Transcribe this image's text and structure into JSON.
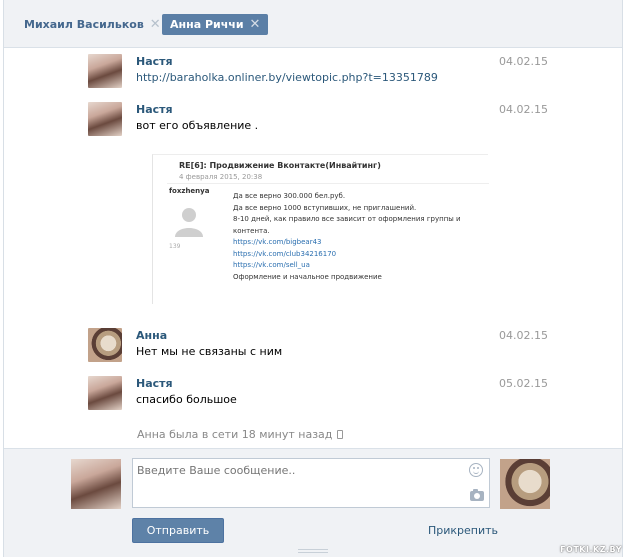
{
  "tabs": [
    {
      "label": "Михаил Васильков",
      "close": "✕"
    },
    {
      "label": "Анна Риччи",
      "close": "✕"
    }
  ],
  "messages": [
    {
      "author": "Настя",
      "date": "04.02.15",
      "text": "http://baraholka.onliner.by/viewtopic.php?t=13351789",
      "avatar": "girl"
    },
    {
      "author": "Настя",
      "date": "04.02.15",
      "text": "вот его объявление .",
      "avatar": "girl"
    },
    {
      "author": "Анна",
      "date": "04.02.15",
      "text": "Нет мы не связаны с ним",
      "avatar": "bear"
    },
    {
      "author": "Настя",
      "date": "05.02.15",
      "text": "спасибо большое",
      "avatar": "girl"
    }
  ],
  "embed": {
    "title": "RE[6]: Продвижение Вконтакте(Инвайтинг)",
    "date": "4 февраля 2015, 20:38",
    "user": "foxzhenya",
    "count": "139",
    "lines": [
      "Да все верно 300.000 бел.руб.",
      "Да все верно 1000 вступивших, не приглашений.",
      "8-10 дней, как правило все зависит от оформления группы и контента.",
      "https://vk.com/bigbear43",
      "https://vk.com/club34216170",
      "https://vk.com/sell_ua",
      "Оформление и начальное продвижение"
    ]
  },
  "status": {
    "text": "Анна была в сети 18 минут назад"
  },
  "compose": {
    "placeholder": "Введите Ваше сообщение..",
    "send_label": "Отправить",
    "attach_label": "Прикрепить"
  },
  "watermark": "FOTKI.KZ.BY",
  "colors": {
    "link": "#2b587a",
    "button": "#5e82a8",
    "active_tab": "#5b7fa6"
  }
}
